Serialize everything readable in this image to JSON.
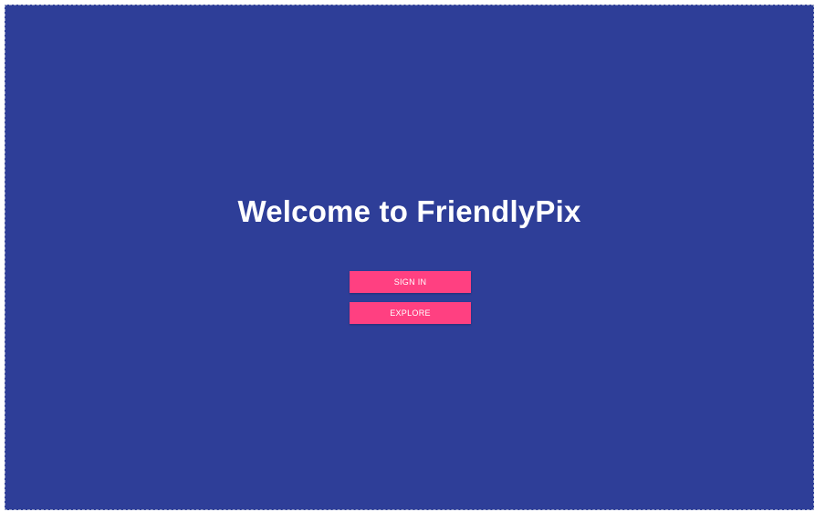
{
  "colors": {
    "background": "#2e3e98",
    "accent": "#ff4081",
    "text": "#ffffff"
  },
  "welcome": {
    "title": "Welcome to FriendlyPix",
    "sign_in_label": "SIGN IN",
    "explore_label": "EXPLORE"
  }
}
